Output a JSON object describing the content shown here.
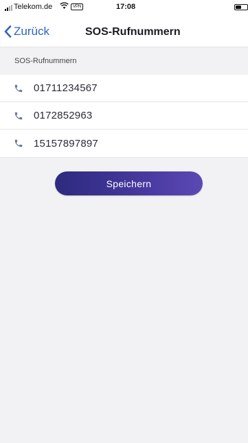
{
  "status_bar": {
    "carrier": "Telekom.de",
    "vpn": "VPN",
    "time": "17:08"
  },
  "nav": {
    "back_label": "Zurück",
    "title": "SOS-Rufnummern"
  },
  "section": {
    "header": "SOS-Rufnummern"
  },
  "numbers": [
    {
      "number": "01711234567"
    },
    {
      "number": "0172852963"
    },
    {
      "number": "15157897897"
    }
  ],
  "actions": {
    "save_label": "Speichern"
  },
  "colors": {
    "accent": "#2e63c4",
    "button": "#3f3491",
    "icon": "#6b7a99"
  }
}
